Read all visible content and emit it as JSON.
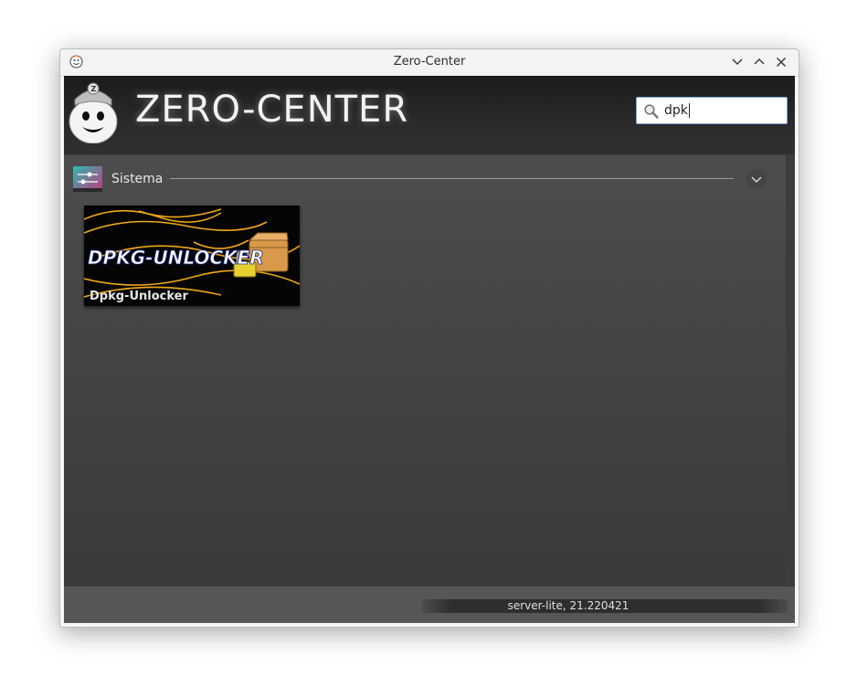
{
  "window": {
    "title": "Zero-Center",
    "controls": [
      "minimize",
      "maximize",
      "close"
    ]
  },
  "header": {
    "brand": "ZERO-CENTER",
    "search": {
      "value": "dpk",
      "icon": "search-icon"
    }
  },
  "categories": [
    {
      "label": "Sistema",
      "expanded": true,
      "apps": [
        {
          "label": "Dpkg-Unlocker",
          "banner_text": "DPKG-UNLOCKER"
        }
      ]
    }
  ],
  "footer": {
    "version": "server-lite, 21.220421"
  },
  "colors": {
    "accent": "#7fa7d8",
    "background": "#3c3c3c"
  }
}
